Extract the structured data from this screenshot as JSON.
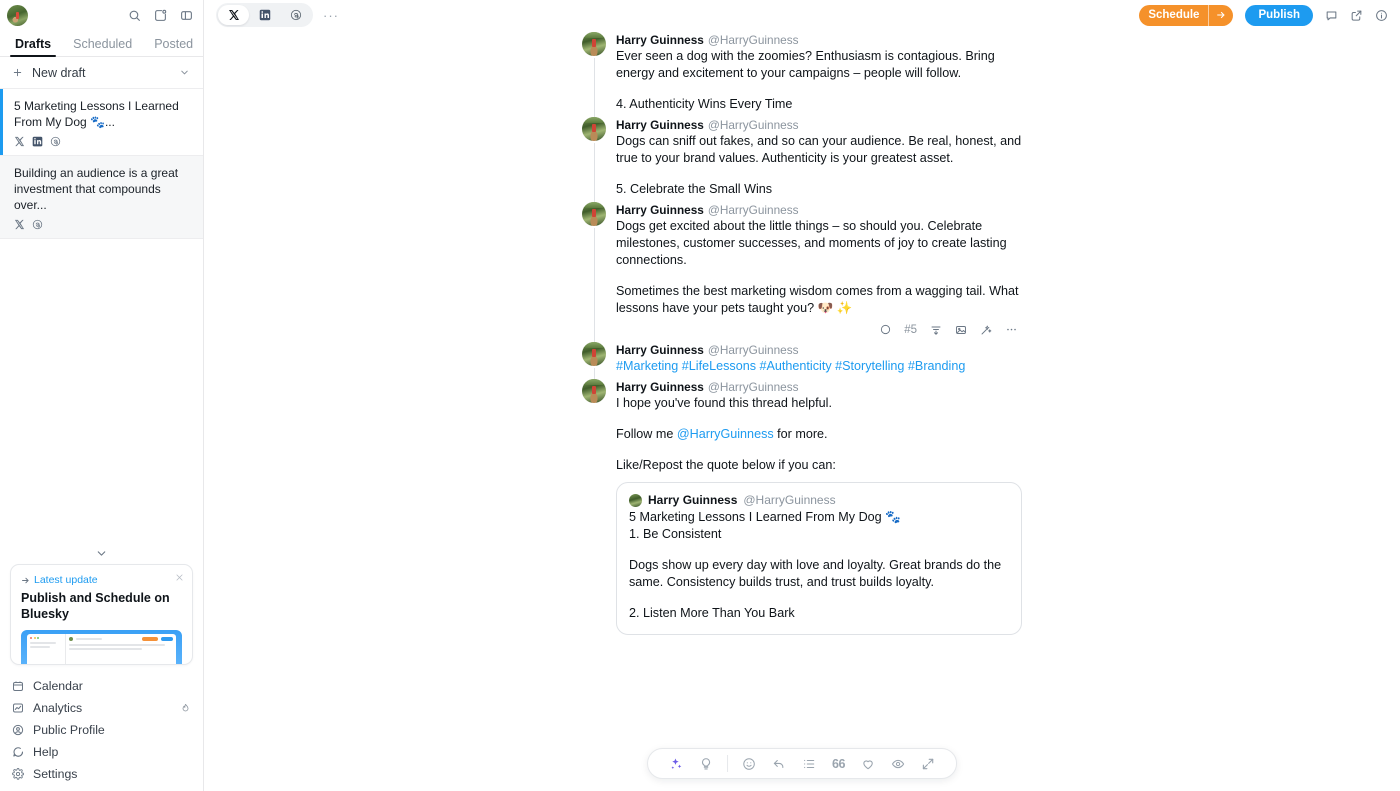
{
  "sidebar": {
    "avatar_name": "user-avatar",
    "top_icons": [
      "search-icon",
      "new-post-icon",
      "panel-toggle-icon"
    ],
    "tabs": [
      {
        "label": "Drafts",
        "active": true
      },
      {
        "label": "Scheduled",
        "active": false
      },
      {
        "label": "Posted",
        "active": false
      }
    ],
    "new_draft_label": "New draft",
    "drafts": [
      {
        "text": "5 Marketing Lessons I Learned From My Dog 🐾...",
        "platforms": [
          "x-icon",
          "linkedin-icon",
          "threads-icon"
        ],
        "selected": true
      },
      {
        "text": "Building an audience is a great investment that compounds over...",
        "platforms": [
          "x-icon",
          "threads-icon"
        ],
        "selected": false
      }
    ],
    "update_card": {
      "tag": "Latest update",
      "title": "Publish and Schedule on Bluesky",
      "close_label": "×"
    },
    "nav": [
      {
        "label": "Calendar",
        "icon": "calendar-icon",
        "badge": null
      },
      {
        "label": "Analytics",
        "icon": "analytics-icon",
        "badge": "flame-icon"
      },
      {
        "label": "Public Profile",
        "icon": "profile-icon",
        "badge": null
      },
      {
        "label": "Help",
        "icon": "help-icon",
        "badge": null
      },
      {
        "label": "Settings",
        "icon": "settings-icon",
        "badge": null
      }
    ]
  },
  "header": {
    "platforms": [
      {
        "name": "x-icon",
        "active": true
      },
      {
        "name": "linkedin-icon",
        "active": false
      },
      {
        "name": "threads-icon",
        "active": false
      }
    ],
    "more_label": "···",
    "schedule_label": "Schedule",
    "publish_label": "Publish",
    "right_icons": [
      "comment-icon",
      "external-link-icon",
      "info-icon"
    ],
    "colors": {
      "schedule": "#f5912a",
      "publish": "#1d9bf0",
      "link": "#1d9bf0"
    }
  },
  "thread": {
    "author_name": "Harry Guinness",
    "author_handle": "@HarryGuinness",
    "posts": [
      {
        "text": "Ever seen a dog with the zoomies? Enthusiasm is contagious. Bring energy and excitement to your campaigns – people will follow.",
        "text2": "4. Authenticity Wins Every Time"
      },
      {
        "text": "Dogs can sniff out fakes, and so can your audience. Be real, honest, and true to your brand values. Authenticity is your greatest asset.",
        "text2": "5. Celebrate the Small Wins"
      },
      {
        "text": "Dogs get excited about the little things – so should you. Celebrate milestones, customer successes, and moments of joy to create lasting connections.",
        "text2": "Sometimes the best marketing wisdom comes from a wagging tail. What lessons have your pets taught you? 🐶 ✨"
      },
      {
        "hashtags": "#Marketing #LifeLessons #Authenticity #Storytelling #Branding"
      },
      {
        "text": "I hope you've found this thread helpful.",
        "follow_prefix": "Follow me ",
        "follow_handle": "@HarryGuinness",
        "follow_suffix": " for more.",
        "quote_intro": "Like/Repost the quote below if you can:"
      }
    ],
    "post_tools": {
      "count_label": "#5",
      "icons": [
        "progress-circle-icon",
        "thread-split-icon",
        "image-icon",
        "magic-wand-icon",
        "more-icon"
      ]
    },
    "quote": {
      "name": "Harry Guinness",
      "handle": "@HarryGuinness",
      "line1": "5 Marketing Lessons I Learned From My Dog 🐾",
      "line2": "1. Be Consistent",
      "line3": "Dogs show up every day with love and loyalty. Great brands do the same. Consistency builds trust, and trust builds loyalty.",
      "line4": "2. Listen More Than You Bark"
    }
  },
  "bottom_toolbar": {
    "quote_label": "66",
    "icons": [
      "ai-sparkle-icon",
      "idea-bulb-icon",
      "emoji-icon",
      "undo-icon",
      "list-icon",
      "quote-icon",
      "heart-icon",
      "eye-icon",
      "expand-icon"
    ]
  }
}
